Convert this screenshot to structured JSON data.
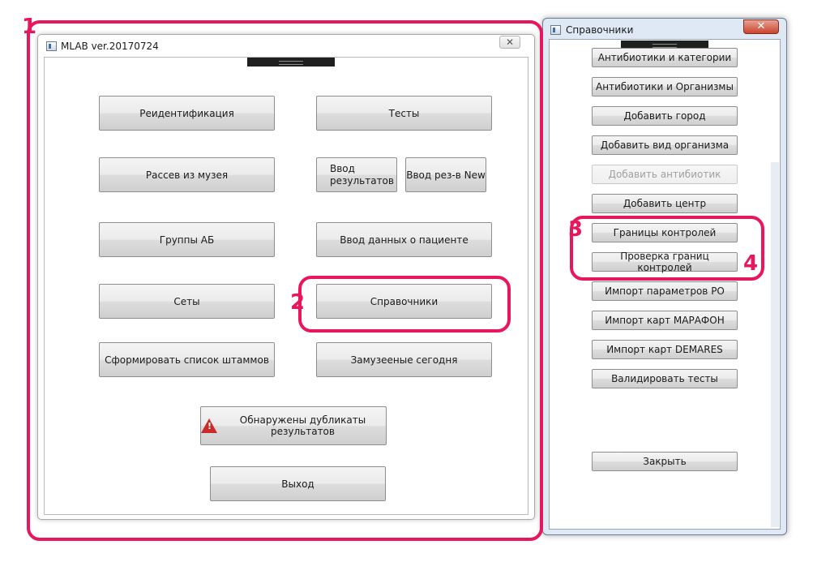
{
  "main_window": {
    "title": "MLAB ver.20170724",
    "close_glyph": "✕",
    "buttons": {
      "reidentification": "Реидентификация",
      "tests": "Тесты",
      "museum_seed": "Рассев из музея",
      "results_entry": "Ввод результатов",
      "results_entry_new": "Ввод рез-в New",
      "ab_groups": "Группы АБ",
      "patient_data": "Ввод данных о пациенте",
      "sets": "Сеты",
      "references": "Справочники",
      "strain_list": "Сформировать список штаммов",
      "today_seeded": "Замузееные сегодня",
      "duplicates": "Обнаружены дубликаты результатов",
      "exit": "Выход"
    }
  },
  "references_window": {
    "title": "Справочники",
    "close_glyph": "✕",
    "buttons": [
      "Антибиотики и категории",
      "Антибиотики и Организмы",
      "Добавить город",
      "Добавить вид организма",
      "Добавить антибиотик",
      "Добавить центр",
      "Границы контролей",
      "Проверка границ контролей",
      "Импорт параметров РО",
      "Импорт карт МАРАФОН",
      "Импорт карт DEMARES",
      "Валидировать тесты"
    ],
    "disabled_button": "Добавить антибиотик",
    "close_button": "Закрыть"
  },
  "annotations": {
    "labels": [
      "1",
      "2",
      "3",
      "4"
    ],
    "color": "#e8175d"
  },
  "icons": {
    "warning": "warning-icon",
    "app": "app-icon"
  }
}
